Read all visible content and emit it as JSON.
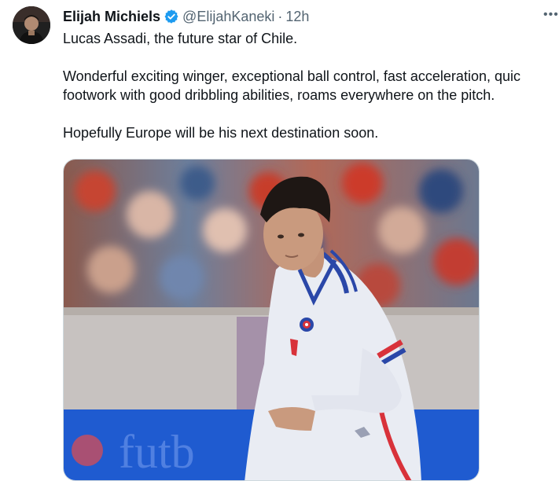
{
  "author": {
    "display_name": "Elijah Michiels",
    "handle": "@ElijahKaneki",
    "separator": "·",
    "time": "12h",
    "avatar_icon": "user-avatar-photo",
    "verified_icon": "verified-badge-icon",
    "verified_color": "#1d9bf0"
  },
  "more_icon": "more-options-icon",
  "more_glyph": "•••",
  "tweet": {
    "line1": "Lucas Assadi, the future star of Chile.",
    "line2": "Wonderful exciting winger, exceptional ball control, fast acceleration, quic",
    "line3": "footwork with good dribbling abilities, roams everywhere on the pitch.",
    "line4": "Hopefully Europe will be his next destination soon."
  },
  "media": {
    "description_icon": "player-photo",
    "shirt_crest": "chile-crest-icon",
    "colors": {
      "shirt": "#e9ecf3",
      "trim_red": "#d8323a",
      "trim_blue": "#2a47a8",
      "board_blue": "#1f5bd0"
    }
  }
}
